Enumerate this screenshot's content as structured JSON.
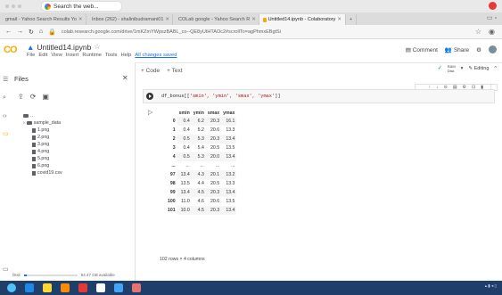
{
  "browser": {
    "search_pill": "Search the web...",
    "tabs": [
      {
        "label": "gmail - Yahoo Search Results Yo",
        "color": "#6001d2",
        "active": false
      },
      {
        "label": "Inbox (262) - shalinibudramani01",
        "color": "#c5221f",
        "active": false
      },
      {
        "label": "COLab google - Yahoo Search R",
        "color": "#6001d2",
        "active": false
      },
      {
        "label": "Untitled14.ipynb - Colaboratory",
        "color": "#f9ab00",
        "active": true
      }
    ],
    "new_tab": "+",
    "url": "colab.research.google.com/drive/1mKZmYWpszBABL_co--QE8yUtHTAOc2#scrollTo=agPhmxEBgtSi"
  },
  "colab": {
    "logo": "CO",
    "notebook_title": "Untitled14.ipynb",
    "menus": [
      "File",
      "Edit",
      "View",
      "Insert",
      "Runtime",
      "Tools",
      "Help"
    ],
    "changes_link": "All changes saved",
    "comment": "Comment",
    "share": "Share",
    "add_code": "+ Code",
    "add_text": "+ Text",
    "ram_label": "RAM",
    "disk_label": "Disk",
    "editing": "Editing"
  },
  "sidebar": {
    "title": "Files",
    "parent": "..",
    "folder": "sample_data",
    "files": [
      "1.png",
      "2.png",
      "3.png",
      "4.png",
      "5.png",
      "6.png",
      "covid19.csv"
    ],
    "disk_text": "Disk",
    "disk_available": "64.47 GB available",
    "disk_used_fraction": 0.06
  },
  "cell": {
    "code_prefix": "df_bonus[[",
    "code_args": "'smin', 'ymin', 'smax', 'ymax'",
    "code_suffix": "]]"
  },
  "table": {
    "columns": [
      "",
      "smin",
      "ymin",
      "smax",
      "ymax"
    ],
    "rows": [
      [
        "0",
        "0.4",
        "6.2",
        "20.3",
        "16.1"
      ],
      [
        "1",
        "0.4",
        "5.2",
        "20.6",
        "13.3"
      ],
      [
        "2",
        "0.5",
        "5.3",
        "20.3",
        "13.4"
      ],
      [
        "3",
        "0.4",
        "5.4",
        "20.5",
        "13.5"
      ],
      [
        "4",
        "0.5",
        "5.3",
        "20.0",
        "13.4"
      ],
      [
        "...",
        "...",
        "...",
        "...",
        "..."
      ],
      [
        "97",
        "13.4",
        "4.3",
        "20.1",
        "13.2"
      ],
      [
        "98",
        "13.5",
        "4.4",
        "20.5",
        "13.3"
      ],
      [
        "99",
        "13.4",
        "4.5",
        "20.3",
        "13.4"
      ],
      [
        "100",
        "11.0",
        "4.6",
        "20.6",
        "13.5"
      ],
      [
        "101",
        "10.0",
        "4.5",
        "20.3",
        "13.4"
      ]
    ],
    "shape_text": "102 rows × 4 columns"
  },
  "taskbar": {
    "apps": [
      "#1e88e5",
      "#fdd835",
      "#fb8c00",
      "#e53935",
      "#ffffff",
      "#42a5f5",
      "#e57373"
    ]
  }
}
